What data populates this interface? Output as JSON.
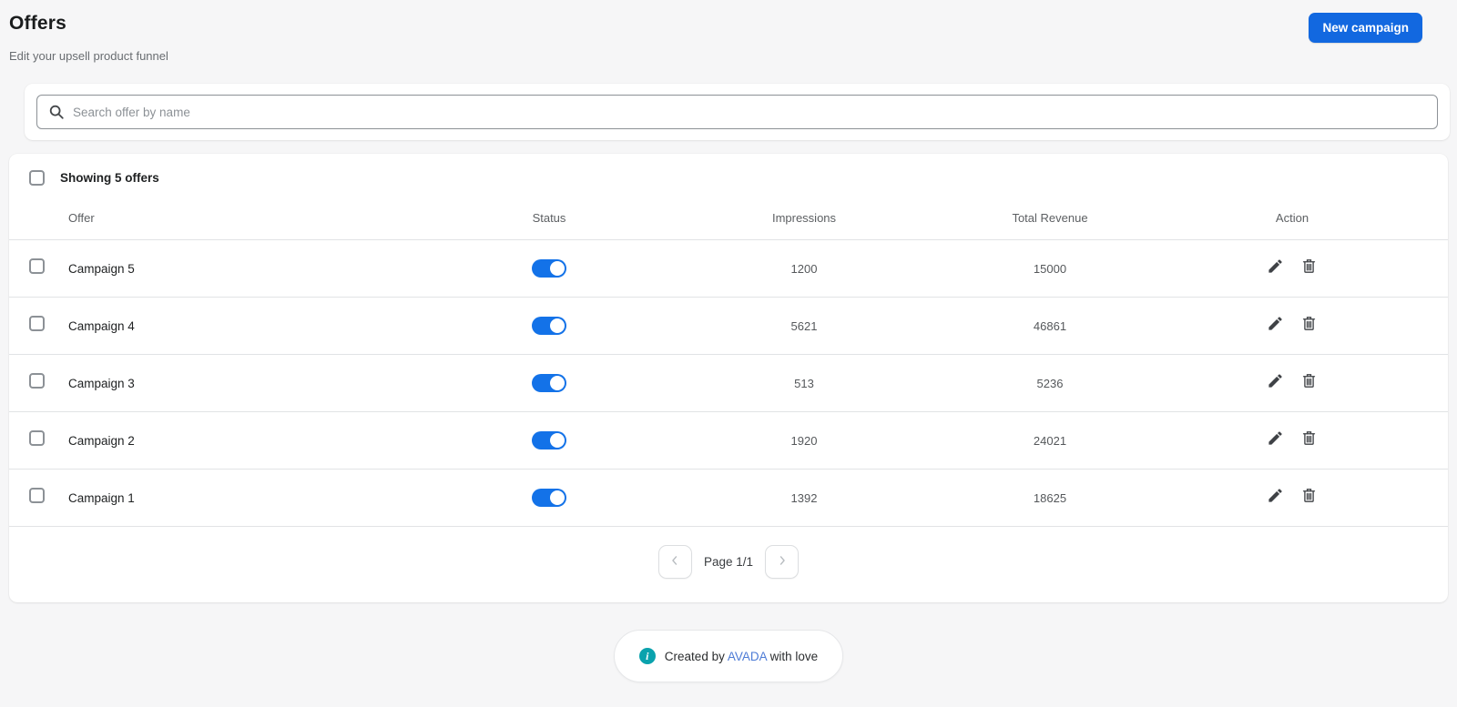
{
  "page": {
    "title": "Offers",
    "subtitle": "Edit your upsell product funnel",
    "new_campaign_label": "New campaign"
  },
  "search": {
    "placeholder": "Search offer by name",
    "value": ""
  },
  "table": {
    "summary": "Showing 5 offers",
    "columns": [
      "Offer",
      "Status",
      "Impressions",
      "Total Revenue",
      "Action"
    ],
    "rows": [
      {
        "name": "Campaign 5",
        "status": "on",
        "impressions": "1200",
        "total_revenue": "15000"
      },
      {
        "name": "Campaign 4",
        "status": "on",
        "impressions": "5621",
        "total_revenue": "46861"
      },
      {
        "name": "Campaign 3",
        "status": "on",
        "impressions": "513",
        "total_revenue": "5236"
      },
      {
        "name": "Campaign 2",
        "status": "on",
        "impressions": "1920",
        "total_revenue": "24021"
      },
      {
        "name": "Campaign 1",
        "status": "on",
        "impressions": "1392",
        "total_revenue": "18625"
      }
    ]
  },
  "pagination": {
    "label": "Page 1/1"
  },
  "footer": {
    "prefix": "Created by",
    "brand": "AVADA",
    "suffix": "with love"
  },
  "colors": {
    "primary_button": "#1268e0",
    "toggle_on": "#1372e8",
    "info_teal": "#0aa2ad",
    "brand_link": "#4d7bd6",
    "page_background": "#f6f6f7"
  }
}
